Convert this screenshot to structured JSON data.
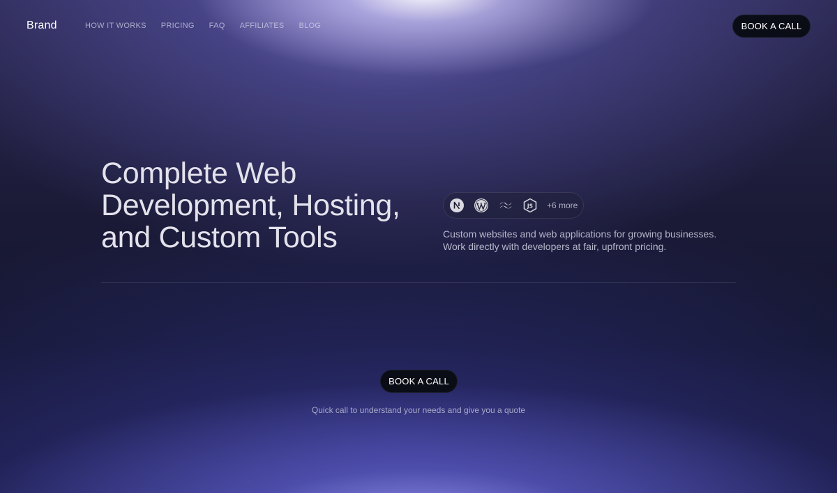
{
  "header": {
    "brand": "Brand",
    "nav": [
      {
        "label": "HOW IT WORKS"
      },
      {
        "label": "PRICING"
      },
      {
        "label": "FAQ"
      },
      {
        "label": "AFFILIATES"
      },
      {
        "label": "BLOG"
      }
    ],
    "cta_label": "BOOK A CALL"
  },
  "hero": {
    "title_lines": [
      "Complete Web",
      "Development, Hosting,",
      "and Custom Tools"
    ],
    "tech_icons": [
      "nextjs-icon",
      "wordpress-icon",
      "tailwind-icon",
      "nodejs-icon"
    ],
    "tech_more": "+6 more",
    "description_lines": [
      "Custom websites and web applications for growing businesses.",
      "Work directly with developers at fair, upfront pricing."
    ]
  },
  "cta": {
    "button_label": "BOOK A CALL",
    "note": "Quick call to understand your needs and give you a quote"
  },
  "colors": {
    "button_bg": "#0b0d16",
    "title_text": "#e3e2ec"
  }
}
